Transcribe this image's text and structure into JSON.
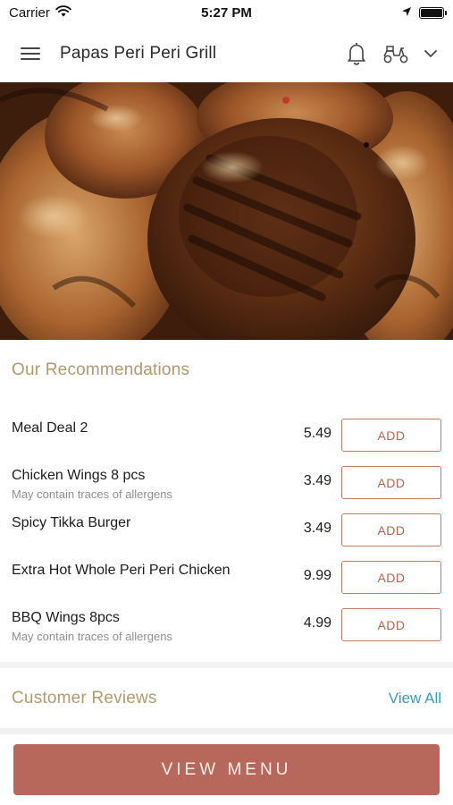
{
  "status_bar": {
    "carrier": "Carrier",
    "time": "5:27 PM"
  },
  "header": {
    "title": "Papas Peri Peri Grill",
    "icons": [
      "menu-icon",
      "bell-icon",
      "scooter-icon",
      "chevron-down-icon"
    ]
  },
  "hero": {
    "icon": "grilled-chicken-photo"
  },
  "recommendations": {
    "title": "Our Recommendations",
    "add_label": "ADD",
    "items": [
      {
        "name": "Meal Deal 2",
        "note": "",
        "price": "5.49"
      },
      {
        "name": "Chicken Wings 8 pcs",
        "note": "May contain traces of allergens",
        "price": "3.49"
      },
      {
        "name": "Spicy Tikka Burger",
        "note": "",
        "price": "3.49"
      },
      {
        "name": "Extra Hot Whole Peri Peri Chicken",
        "note": "",
        "price": "9.99"
      },
      {
        "name": "BBQ Wings 8pcs",
        "note": "May contain traces of allergens",
        "price": "4.99"
      }
    ]
  },
  "reviews": {
    "title": "Customer Reviews",
    "view_all": "View All"
  },
  "footer": {
    "view_menu": "VIEW MENU"
  },
  "colors": {
    "accent": "#b8685a",
    "section_title": "#b29a6a",
    "link": "#3a9bc4"
  }
}
